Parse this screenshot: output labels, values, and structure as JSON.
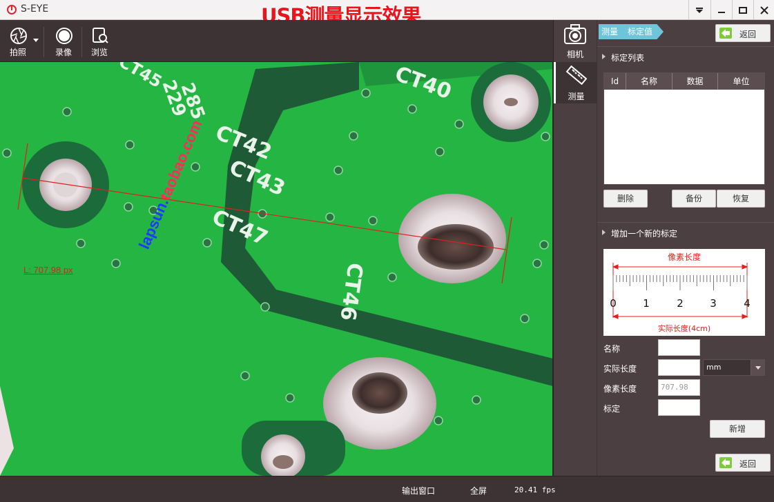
{
  "window": {
    "title": "S-EYE",
    "overlay_heading": "USB测量显示效果"
  },
  "toolbar": {
    "photo_label": "拍照",
    "record_label": "录像",
    "browse_label": "浏览"
  },
  "camera": {
    "measurement_label": "L: 707.98 px",
    "watermark_main": "lapsun.",
    "watermark_sub": "taobao.com",
    "board_silkscreen": [
      "CT40",
      "CT42",
      "CT43",
      "CT47",
      "CT46",
      "229",
      "285",
      "CT45"
    ]
  },
  "nav": {
    "camera_label": "相机",
    "measure_label": "测量"
  },
  "panel": {
    "breadcrumb": [
      "测量",
      "标定值"
    ],
    "back_label": "返回",
    "list_section_title": "标定列表",
    "table_columns": [
      "Id",
      "名称",
      "数据",
      "单位"
    ],
    "table_rows": [],
    "delete_label": "删除",
    "backup_label": "备份",
    "restore_label": "恢复",
    "new_section_title": "增加一个新的标定",
    "ruler": {
      "pixel_length_label": "像素长度",
      "actual_length_label": "实际长度(4cm)",
      "ticks": [
        "0",
        "1",
        "2",
        "3",
        "4"
      ]
    },
    "form": {
      "name_label": "名称",
      "name_value": "",
      "actual_length_label": "实际长度",
      "actual_length_value": "",
      "unit_value": "mm",
      "pixel_length_label": "像素长度",
      "pixel_length_value": "707.98",
      "calib_label": "标定",
      "calib_value": "",
      "add_label": "新增"
    }
  },
  "status": {
    "output_window": "输出窗口",
    "fullscreen": "全屏",
    "fps": "20.41 fps"
  },
  "colors": {
    "chrome_bg": "#3d3234",
    "panel_bg": "#4b3f42",
    "pcb_green": "#1fa83a",
    "measure_line": "#e0201c",
    "breadcrumb": "#6ec4d8",
    "back_arrow": "#7fcb3c"
  }
}
